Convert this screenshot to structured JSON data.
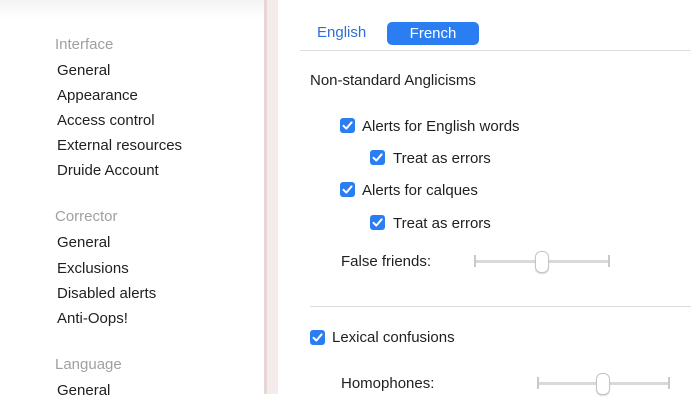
{
  "sidebar": {
    "sections": [
      {
        "header": "Interface",
        "items": [
          "General",
          "Appearance",
          "Access control",
          "External resources",
          "Druide Account"
        ]
      },
      {
        "header": "Corrector",
        "items": [
          "General",
          "Exclusions",
          "Disabled alerts",
          "Anti-Oops!"
        ]
      },
      {
        "header": "Language",
        "items": [
          "General"
        ]
      }
    ]
  },
  "tabs": {
    "english": "English",
    "french": "French",
    "selected": "French"
  },
  "main": {
    "anglicisms_title": "Non-standard Anglicisms",
    "alerts_english_words": {
      "label": "Alerts for English words",
      "checked": true
    },
    "treat_errors_1": {
      "label": "Treat as errors",
      "checked": true
    },
    "alerts_calques": {
      "label": "Alerts for calques",
      "checked": true
    },
    "treat_errors_2": {
      "label": "Treat as errors",
      "checked": true
    },
    "false_friends": {
      "label": "False friends:",
      "level": 0.5
    },
    "lexical_confusions": {
      "label": "Lexical confusions",
      "checked": true
    },
    "homophones": {
      "label": "Homophones:",
      "level": 0.5
    }
  },
  "colors": {
    "accent": "#2b7ef2",
    "tab_text": "#2d6fd7",
    "section_header": "#a0a0a0"
  }
}
